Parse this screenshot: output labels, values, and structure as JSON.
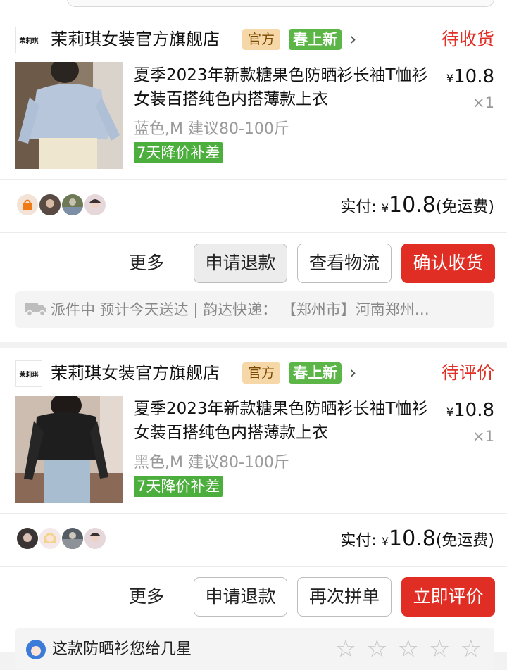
{
  "orders": [
    {
      "shop_logo_text": "茉莉琪",
      "shop_name": "茉莉琪女装官方旗舰店",
      "tag_official": "官方",
      "tag_new": "春上新",
      "status": "待收货",
      "title": "夏季2023年新款糖果色防晒衫长袖T恤衫女装百搭纯色内搭薄款上衣",
      "price_symbol": "¥",
      "price": "10.8",
      "qty": "×1",
      "spec": "蓝色,M 建议80-100斤",
      "badge": "7天降价补差",
      "paid_label": "实付:",
      "paid_symbol": "¥",
      "paid_amount": "10.8",
      "paid_note": "(免运费)",
      "more": "更多",
      "btn_refund": "申请退款",
      "btn_secondary": "查看物流",
      "btn_primary": "确认收货",
      "logistics": "派件中 预计今天送达 | 韵达快递： 【郑州市】河南郑州…"
    },
    {
      "shop_logo_text": "茉莉琪",
      "shop_name": "茉莉琪女装官方旗舰店",
      "tag_official": "官方",
      "tag_new": "春上新",
      "status": "待评价",
      "title": "夏季2023年新款糖果色防晒衫长袖T恤衫女装百搭纯色内搭薄款上衣",
      "price_symbol": "¥",
      "price": "10.8",
      "qty": "×1",
      "spec": "黑色,M 建议80-100斤",
      "badge": "7天降价补差",
      "paid_label": "实付:",
      "paid_symbol": "¥",
      "paid_amount": "10.8",
      "paid_note": "(免运费)",
      "more": "更多",
      "btn_refund": "申请退款",
      "btn_secondary": "再次拼单",
      "btn_primary": "立即评价",
      "review_question": "这款防晒衫您给几星"
    }
  ],
  "colors": {
    "accent_red": "#e02e24",
    "badge_green": "#4cae3c",
    "tag_gold": "#f6d8a8"
  },
  "icons": [
    "chevron-right-icon",
    "truck-icon",
    "star-icon"
  ]
}
